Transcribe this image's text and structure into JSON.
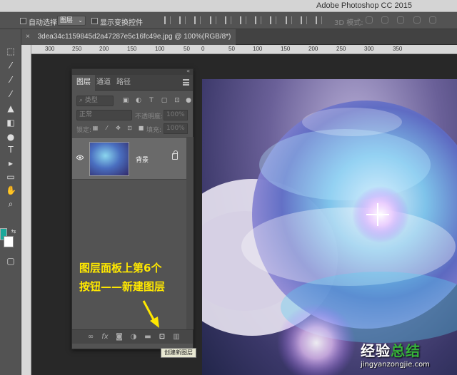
{
  "app": {
    "title": "Adobe Photoshop CC 2015"
  },
  "options_bar": {
    "auto_select_label": "自动选择:",
    "auto_select_value": "图层",
    "show_transform_label": "显示变换控件",
    "mode_3d_label": "3D 模式:"
  },
  "document": {
    "tab_label": "3dea34c1159845d2a47287e5c16fc49e.jpg @ 100%(RGB/8*)"
  },
  "ruler": {
    "ticks": [
      "300",
      "250",
      "200",
      "150",
      "100",
      "50",
      "0",
      "50",
      "100",
      "150",
      "200",
      "250",
      "300",
      "350"
    ]
  },
  "layers_panel": {
    "tabs": [
      {
        "label": "图层",
        "active": true
      },
      {
        "label": "通道",
        "active": false
      },
      {
        "label": "路径",
        "active": false
      }
    ],
    "filter_kind": "类型",
    "blend_mode": "正常",
    "opacity_label": "不透明度:",
    "opacity_value": "100%",
    "lock_label": "锁定:",
    "fill_label": "填充:",
    "fill_value": "100%",
    "layers": [
      {
        "name": "背景",
        "visible": true,
        "locked": true
      }
    ],
    "bottom_icons": [
      "link-icon",
      "fx-icon",
      "mask-icon",
      "adjustment-icon",
      "folder-icon",
      "new-layer-icon",
      "trash-icon"
    ],
    "tooltip": "创建新图层"
  },
  "annotation": {
    "line1": "图层面板上第6个",
    "line2": "按钮——新建图层",
    "color": "#ffe800"
  },
  "watermark": {
    "brand_a": "经验",
    "brand_b": "总结",
    "url": "jingyanzongjie.com"
  },
  "colors": {
    "foreground": "#1aa89a",
    "background": "#ffffff"
  }
}
